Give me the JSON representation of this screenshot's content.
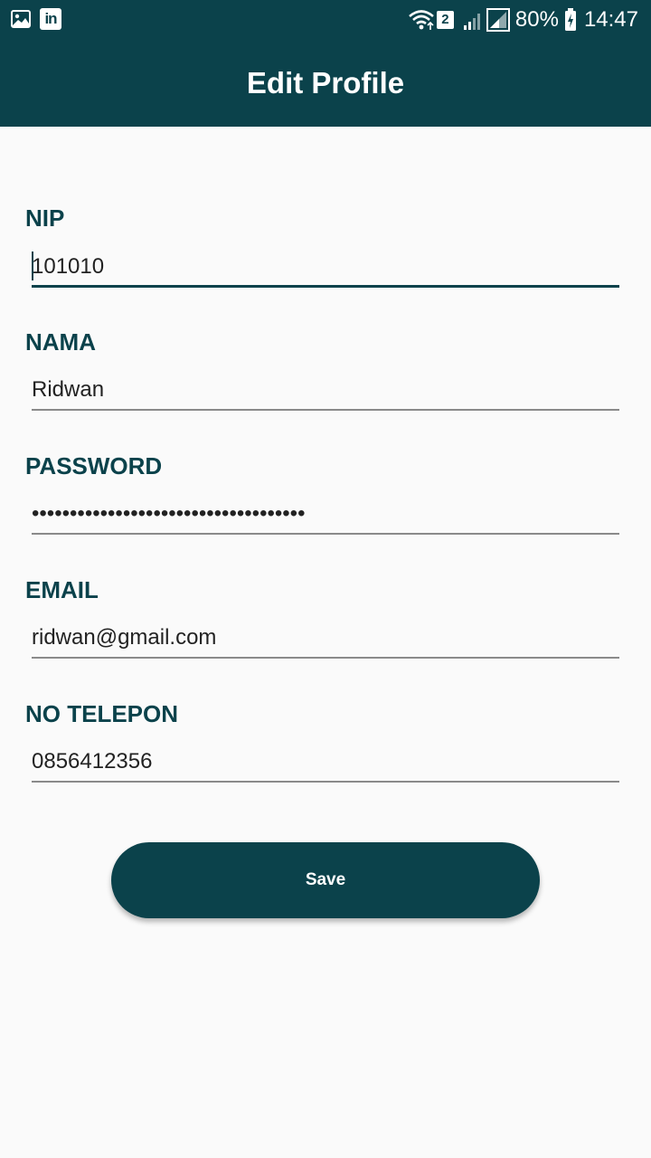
{
  "status_bar": {
    "left_icons": [
      "image-icon",
      "linkedin-icon"
    ],
    "sim_badge": "2",
    "battery_percent": "80%",
    "time": "14:47"
  },
  "header": {
    "title": "Edit Profile"
  },
  "form": {
    "nip": {
      "label": "NIP",
      "value": "101010"
    },
    "nama": {
      "label": "NAMA",
      "value": "Ridwan"
    },
    "password": {
      "label": "PASSWORD",
      "value": "••••••••••••••••••••••••••••••••••••"
    },
    "email": {
      "label": "EMAIL",
      "value": "ridwan@gmail.com"
    },
    "telepon": {
      "label": "NO TELEPON",
      "value": "0856412356"
    }
  },
  "actions": {
    "save_label": "Save"
  },
  "colors": {
    "primary": "#0b424b",
    "background": "#fafafa",
    "underline": "#8a8a8a"
  }
}
